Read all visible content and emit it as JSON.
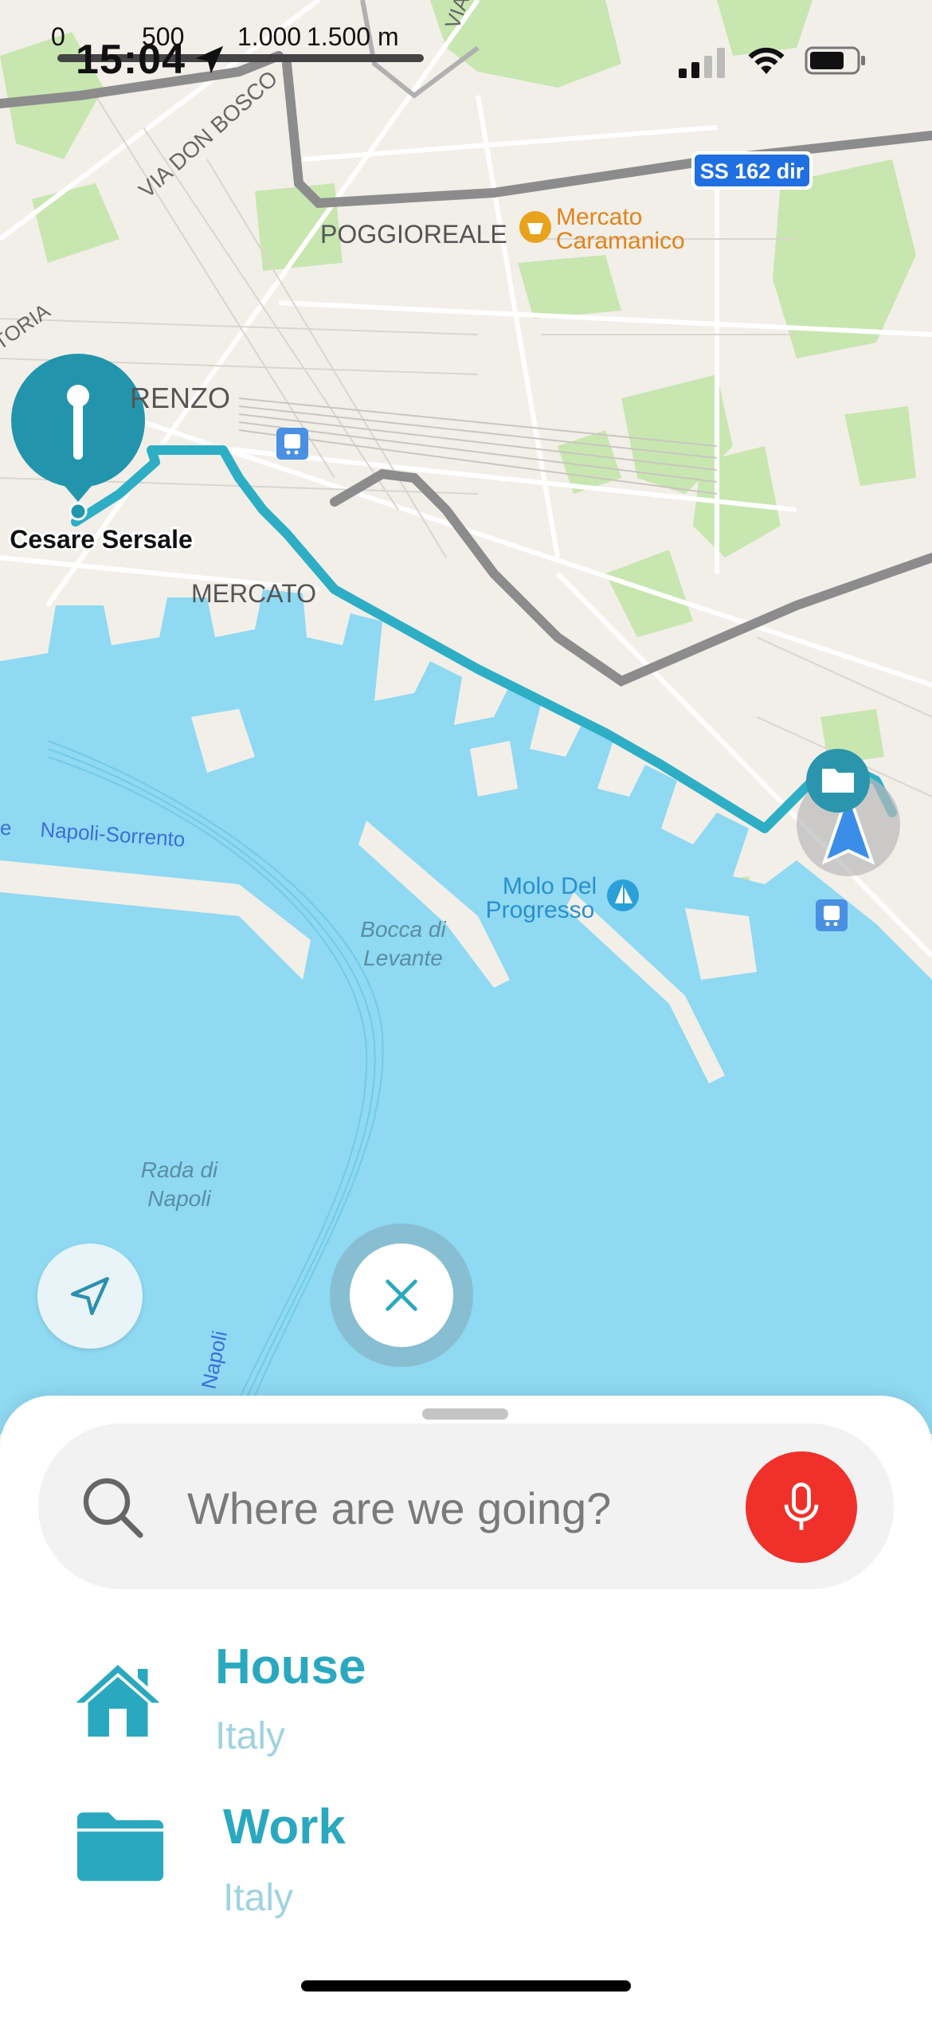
{
  "status_bar": {
    "time": "15:04",
    "scale_labels": [
      "0",
      "500",
      "1.000",
      "1.500 m"
    ]
  },
  "map": {
    "labels": {
      "via_don_bosco": "VIA DON BOSCO",
      "toria": "TORIA",
      "poggioreale": "POGGIOREALE",
      "renzo": "RENZO",
      "mercato": "MERCATO",
      "mercato_caramanico_1": "Mercato",
      "mercato_caramanico_2": "Caramanico",
      "road_shield": "SS 162 dir",
      "cesare_sersale": "Cesare Sersale",
      "napoli_sorrento": "Napoli-Sorrento",
      "napoli_sorrento_prefix": "e",
      "molo_1": "Molo Del",
      "molo_2": "Progresso",
      "bocca_1": "Bocca di",
      "bocca_2": "Levante",
      "rada_1": "Rada di",
      "rada_2": "Napoli",
      "napoli_vertical": "Napoli",
      "via_top": "VIA"
    },
    "colors": {
      "water": "#8fd9f2",
      "land": "#f2efe9",
      "park": "#c8e6b0",
      "route": "#2eaec5",
      "road": "#8c8c8c",
      "poi_orange": "#e2831b"
    }
  },
  "sheet": {
    "search_placeholder": "Where are we going?",
    "favorites": [
      {
        "icon": "house-icon",
        "title": "House",
        "subtitle": "Italy"
      },
      {
        "icon": "folder-icon",
        "title": "Work",
        "subtitle": "Italy"
      }
    ],
    "colors": {
      "accent": "#2aa8c0",
      "mic": "#f0302a"
    }
  }
}
